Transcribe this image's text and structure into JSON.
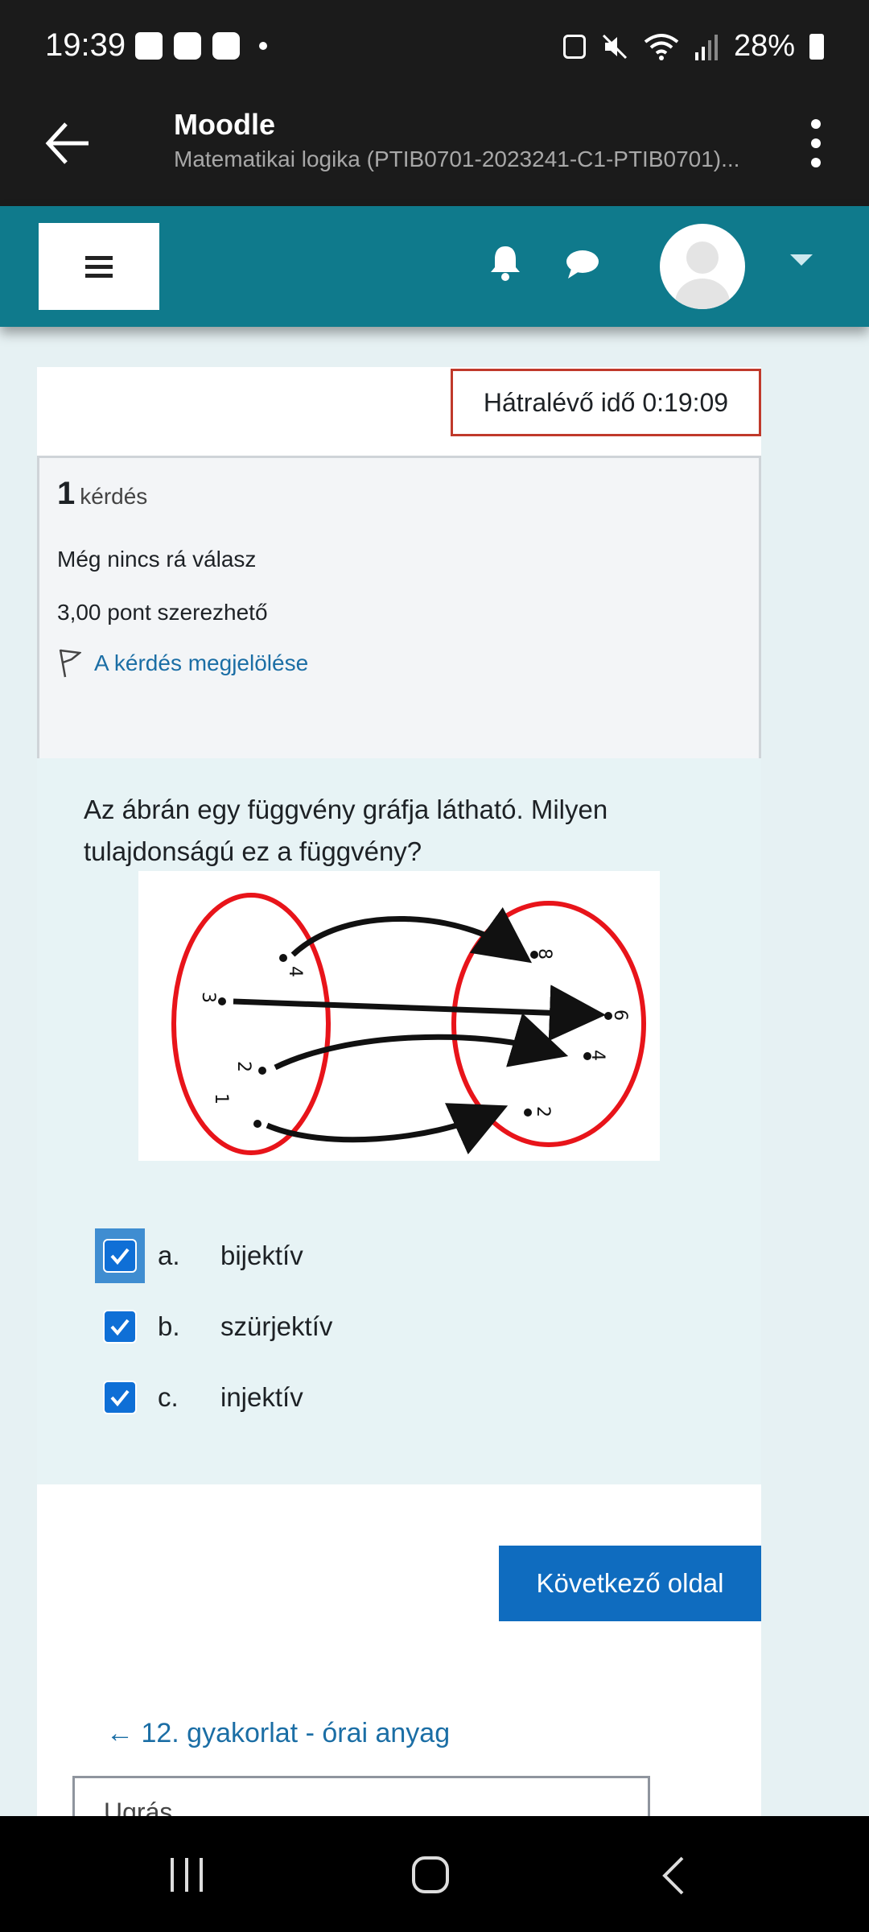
{
  "status_bar": {
    "time": "19:39",
    "battery": "28%"
  },
  "app_bar": {
    "title": "Moodle",
    "subtitle": "Matematikai logika (PTIB0701-2023241-C1-PTIB0701)..."
  },
  "quiz": {
    "timer": "Hátralévő idő 0:19:09",
    "question_number": "1",
    "question_word": "kérdés",
    "state": "Még nincs rá válasz",
    "grade": "3,00 pont szerezhető",
    "flag_label": "A kérdés megjelölése",
    "question_text": "Az ábrán egy függvény gráfja látható. Milyen tulajdonságú ez a függvény?",
    "diagram": {
      "domain_labels": [
        "4",
        "3",
        "2",
        "1"
      ],
      "codomain_labels": [
        "8",
        "6",
        "4",
        "2"
      ]
    },
    "answers": [
      {
        "letter": "a.",
        "text": "bijektív",
        "checked": true
      },
      {
        "letter": "b.",
        "text": "szürjektív",
        "checked": true
      },
      {
        "letter": "c.",
        "text": "injektív",
        "checked": true
      }
    ],
    "next_button": "Következő oldal",
    "prev_link": "← 12. gyakorlat - órai  anyag",
    "jump_select": "Ugrás..."
  },
  "colors": {
    "nav_teal": "#0f7a8c",
    "primary_blue": "#0f6cbf",
    "timer_border": "#c0392b"
  }
}
